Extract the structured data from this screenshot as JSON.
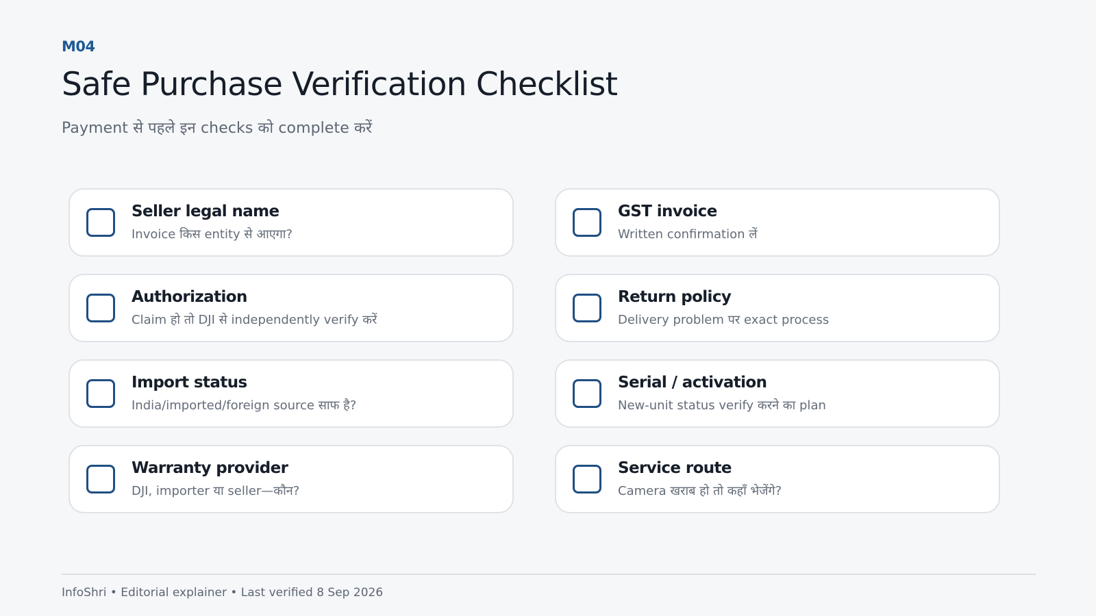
{
  "header": {
    "module_code": "M04",
    "title": "Safe Purchase Verification Checklist",
    "subtitle": "Payment से पहले इन checks को complete करें"
  },
  "checklist": [
    {
      "title": "Seller legal name",
      "description": "Invoice किस entity से आएगा?"
    },
    {
      "title": "GST invoice",
      "description": "Written confirmation लें"
    },
    {
      "title": "Authorization",
      "description": "Claim हो तो DJI से independently verify करें"
    },
    {
      "title": "Return policy",
      "description": "Delivery problem पर exact process"
    },
    {
      "title": "Import status",
      "description": "India/imported/foreign source साफ है?"
    },
    {
      "title": "Serial / activation",
      "description": "New-unit status verify करने का plan"
    },
    {
      "title": "Warranty provider",
      "description": "DJI, importer या seller—कौन?"
    },
    {
      "title": "Service route",
      "description": "Camera खराब हो तो कहाँ भेजेंगे?"
    }
  ],
  "footer": {
    "text": "InfoShri • Editorial explainer • Last verified 8 Sep 2026"
  },
  "colors": {
    "background": "#f6f7f9",
    "accent": "#1f5a94",
    "checkbox_border": "#1f4e82",
    "card_border": "#dfe2e7"
  },
  "icons": {
    "checkbox": "empty-checkbox-icon"
  }
}
